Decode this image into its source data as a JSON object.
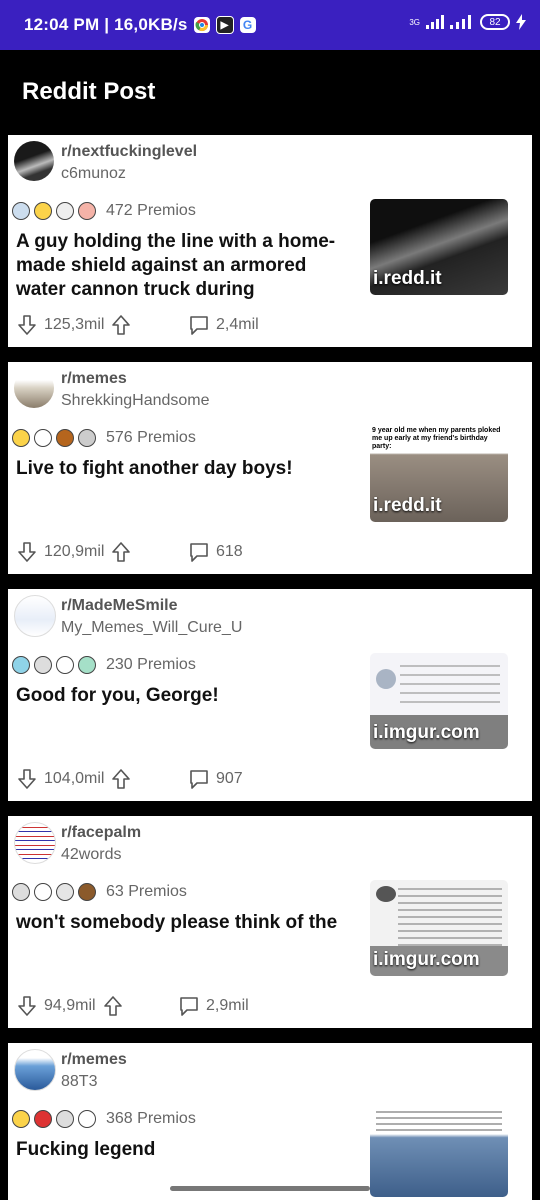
{
  "status_bar": {
    "time_speed": "12:04 PM | 16,0KB/s",
    "network": "3G",
    "battery": "82"
  },
  "appbar": {
    "title": "Reddit Post"
  },
  "posts": [
    {
      "subreddit": "r/nextfuckinglevel",
      "author": "c6munoz",
      "awards": "472 Premios",
      "title": "A guy holding the line with a home-made shield against an armored water cannon truck during",
      "thumb_label": "i.redd.it",
      "thumb_color": "#2a2a2a",
      "upvotes": "125,3mil",
      "comments": "2,4mil"
    },
    {
      "subreddit": "r/memes",
      "author": "ShrekkingHandsome",
      "awards": "576 Premios",
      "title": "Live to fight another day boys!",
      "thumb_label": "i.redd.it",
      "thumb_color": "#8a7f74",
      "thumb_caption": "9 year old me when my parents ploked me up early at my friend's birthday party:",
      "upvotes": "120,9mil",
      "comments": "618"
    },
    {
      "subreddit": "r/MadeMeSmile",
      "author": "My_Memes_Will_Cure_U",
      "awards": "230 Premios",
      "title": "Good for you, George!",
      "thumb_label": "i.imgur.com",
      "thumb_color": "#e9e9ef",
      "upvotes": "104,0mil",
      "comments": "907"
    },
    {
      "subreddit": "r/facepalm",
      "author": "42words",
      "awards": "63 Premios",
      "title": "won't somebody please think of the",
      "thumb_label": "i.imgur.com",
      "thumb_color": "#eeeeee",
      "upvotes": "94,9mil",
      "comments": "2,9mil"
    },
    {
      "subreddit": "r/memes",
      "author": "88T3",
      "awards": "368 Premios",
      "title": "Fucking legend",
      "thumb_label": "",
      "thumb_color": "#dcdcdc",
      "upvotes": "",
      "comments": ""
    }
  ]
}
